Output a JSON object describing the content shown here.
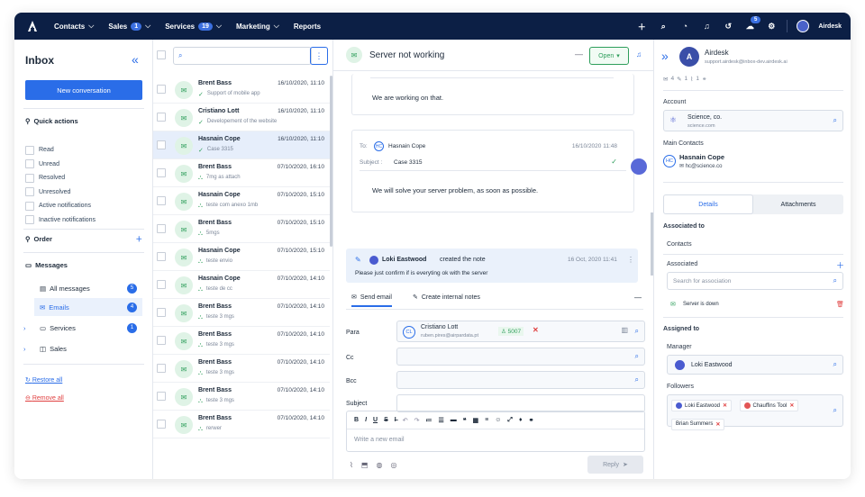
{
  "topbar": {
    "nav": [
      {
        "label": "Contacts",
        "badge": ""
      },
      {
        "label": "Sales",
        "badge": "1"
      },
      {
        "label": "Services",
        "badge": "19"
      },
      {
        "label": "Marketing",
        "badge": ""
      },
      {
        "label": "Reports",
        "badge": ""
      }
    ],
    "notif_badge": "5",
    "user": "Airdesk"
  },
  "sidebar": {
    "title": "Inbox",
    "new_conversation": "New conversation",
    "quick_actions_label": "Quick actions",
    "quick_actions": [
      "Read",
      "Unread",
      "Resolved",
      "Unresolved",
      "Active notifications",
      "Inactive notifications"
    ],
    "order_label": "Order",
    "messages_label": "Messages",
    "messages": [
      {
        "label": "All messages",
        "count": "5"
      },
      {
        "label": "Emails",
        "count": "4"
      },
      {
        "label": "Services",
        "count": "1"
      },
      {
        "label": "Sales",
        "count": ""
      }
    ],
    "restore_all": "Restore all",
    "remove_all": "Remove all"
  },
  "list": {
    "search_placeholder": "",
    "items": [
      {
        "name": "Brent Bass",
        "date": "16/10/2020, 11:10",
        "sub": "Support of mobile app",
        "icon": "check-icon"
      },
      {
        "name": "Cristiano Lott",
        "date": "16/10/2020, 11:10",
        "sub": "Developement of the website",
        "icon": "check-icon"
      },
      {
        "name": "Hasnain Cope",
        "date": "16/10/2020, 11:10",
        "sub": "Case 3315",
        "icon": "check-icon"
      },
      {
        "name": "Brent Bass",
        "date": "07/10/2020, 16:10",
        "sub": "7mg as attach",
        "icon": "org-icon"
      },
      {
        "name": "Hasnain Cope",
        "date": "07/10/2020, 15:10",
        "sub": "teste com anexo 1mb",
        "icon": "org-icon"
      },
      {
        "name": "Brent Bass",
        "date": "07/10/2020, 15:10",
        "sub": "5mgs",
        "icon": "org-icon"
      },
      {
        "name": "Hasnain Cope",
        "date": "07/10/2020, 15:10",
        "sub": "teste envio",
        "icon": "org-icon"
      },
      {
        "name": "Hasnain Cope",
        "date": "07/10/2020, 14:10",
        "sub": "teste de cc",
        "icon": "org-icon"
      },
      {
        "name": "Brent Bass",
        "date": "07/10/2020, 14:10",
        "sub": "teste 3 mgs",
        "icon": "org-icon"
      },
      {
        "name": "Brent Bass",
        "date": "07/10/2020, 14:10",
        "sub": "teste 3 mgs",
        "icon": "org-icon"
      },
      {
        "name": "Brent Bass",
        "date": "07/10/2020, 14:10",
        "sub": "teste 3 mgs",
        "icon": "org-icon"
      },
      {
        "name": "Brent Bass",
        "date": "07/10/2020, 14:10",
        "sub": "teste 3 mgs",
        "icon": "org-icon"
      },
      {
        "name": "Brent Bass",
        "date": "07/10/2020, 14:10",
        "sub": "rerwer",
        "icon": "org-icon"
      }
    ]
  },
  "conversation": {
    "title": "Server not working",
    "status": "Open",
    "msg1": "We are working on that.",
    "to_label": "To:",
    "to_initials": "HC",
    "to_name": "Hasnain Cope",
    "msg2_date": "16/10/2020 11:48",
    "subject_label": "Subject :",
    "subject": "Case 3315",
    "msg2_body": "We will solve your server problem, as soon as possible.",
    "note_author": "Loki Eastwood",
    "note_action": "created the note",
    "note_date": "16 Oct, 2020 11:41",
    "note_body": "Please just confirm if is everyting ok with the server",
    "tab_send": "Send email",
    "tab_notes": "Create internal notes",
    "para_label": "Para",
    "cc_label": "Cc",
    "bcc_label": "Bcc",
    "subject_field_label": "Subject",
    "recipient_initials": "CL",
    "recipient_name": "Cristiano Lott",
    "recipient_email": "ruben.pires@airpardata.pt",
    "recipient_id": "5007",
    "editor_placeholder": "Write a new email",
    "reply": "Reply"
  },
  "right": {
    "name": "Airdesk",
    "email": "support.airdesk@inbox-dev.airdesk.ai",
    "stats": [
      "4",
      "1",
      "1"
    ],
    "account_label": "Account",
    "account_name": "Science, co.",
    "account_site": "science.com",
    "main_contacts_label": "Main Contacts",
    "contact_initials": "HC",
    "contact_name": "Hasnain Cope",
    "contact_email": "hc@science.co",
    "tab_details": "Details",
    "tab_attachments": "Attachments",
    "associated_to": "Associated to",
    "contacts_label": "Contacts",
    "associated_label": "Associated",
    "assoc_placeholder": "Search for association",
    "assoc_item": "Server is down",
    "assigned_to": "Assigned to",
    "manager_label": "Manager",
    "manager_name": "Loki Eastwood",
    "followers_label": "Followers",
    "followers": [
      {
        "name": "Loki Eastwood",
        "color": "#4a5bd0"
      },
      {
        "name": "Chauffins Tool",
        "color": "#e25555"
      },
      {
        "name": "Brian Summers",
        "color": ""
      }
    ]
  },
  "colors": {
    "accent": "#2a6de8",
    "navy": "#0c1f45",
    "success": "#2e9e5b"
  }
}
